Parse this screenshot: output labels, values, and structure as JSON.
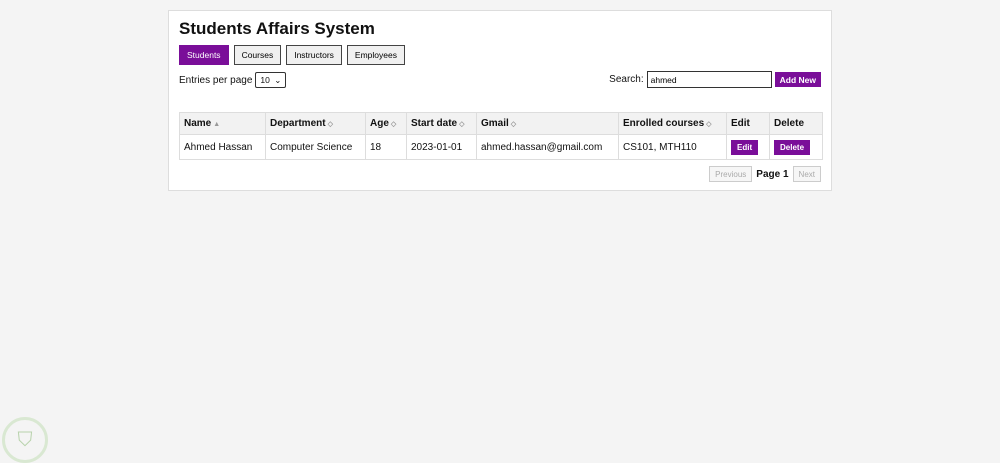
{
  "title": "Students Affairs System",
  "nav": [
    {
      "label": "Students",
      "active": true
    },
    {
      "label": "Courses"
    },
    {
      "label": "Instructors"
    },
    {
      "label": "Employees"
    }
  ],
  "entries": {
    "label": "Entries per page",
    "value": "10"
  },
  "search": {
    "label": "Search:",
    "value": "ahmed"
  },
  "add_new": "Add New",
  "table": {
    "headers": [
      "Name",
      "Department",
      "Age",
      "Start date",
      "Gmail",
      "Enrolled courses",
      "Edit",
      "Delete"
    ],
    "sort": {
      "Name": "ascending"
    },
    "rows": [
      {
        "name": "Ahmed Hassan",
        "department": "Computer Science",
        "age": "18",
        "start_date": "2023-01-01",
        "gmail": "ahmed.hassan@gmail.com",
        "courses": "CS101, MTH110",
        "edit": "Edit",
        "delete": "Delete"
      }
    ]
  },
  "pager": {
    "previous": "Previous",
    "page": "Page 1",
    "next": "Next"
  },
  "colors": {
    "accent": "#7a0e99"
  }
}
